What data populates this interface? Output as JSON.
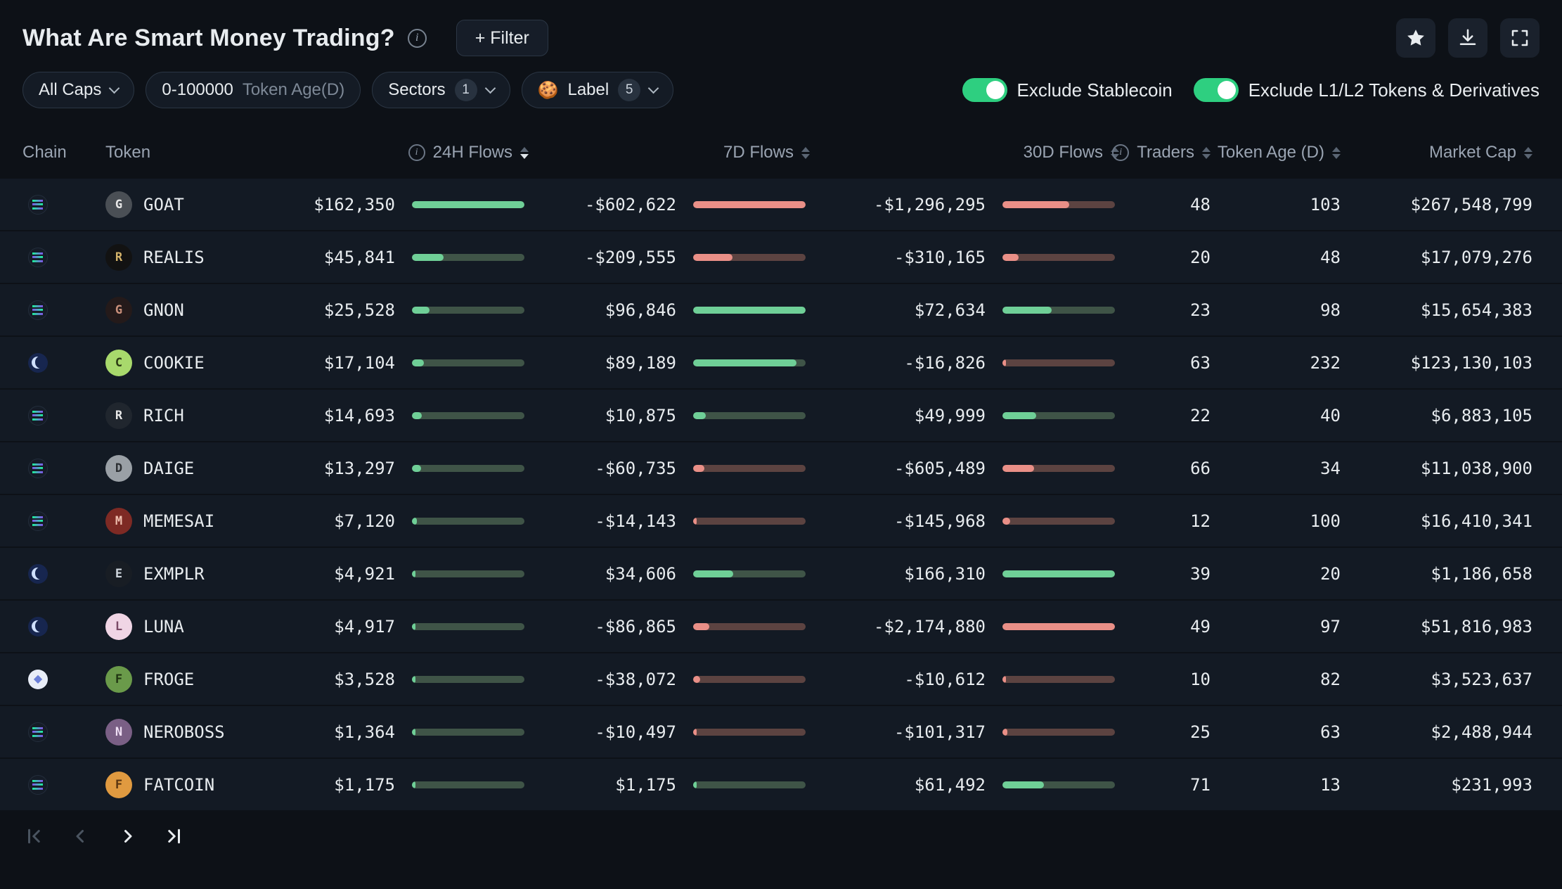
{
  "header": {
    "title": "What Are Smart Money Trading?",
    "filter_button": "+ Filter"
  },
  "filters": {
    "all_caps": "All Caps",
    "token_age_value": "0-100000",
    "token_age_label": "Token Age(D)",
    "sectors_label": "Sectors",
    "sectors_count": "1",
    "label_emoji": "🍪",
    "label_label": "Label",
    "label_count": "5",
    "toggle_stablecoin": "Exclude Stablecoin",
    "toggle_l1l2": "Exclude L1/L2 Tokens & Derivatives"
  },
  "icons": {
    "header_actions": [
      "favorite-icon",
      "download-icon",
      "fullscreen-icon"
    ],
    "pagination": [
      "first-page-icon",
      "prev-page-icon",
      "next-page-icon",
      "last-page-icon"
    ]
  },
  "colors": {
    "bg": "#0d1117",
    "row_bg": "#131a24",
    "accent_green": "#2ecf80",
    "bar_pos": "#6fcf97",
    "bar_pos_track": "#3f5447",
    "bar_neg": "#e98f87",
    "bar_neg_track": "#5c4341"
  },
  "table": {
    "columns": [
      "Chain",
      "Token",
      "24H Flows",
      "7D Flows",
      "30D Flows",
      "Traders",
      "Token Age (D)",
      "Market Cap"
    ],
    "rows": [
      {
        "chain": "solana",
        "token": "GOAT",
        "icon_bg": "#4a4f55",
        "icon_fg": "#e9e9e9",
        "flow_24h": "$162,350",
        "flow_7d": "-$602,622",
        "flow_30d": "-$1,296,295",
        "traders": "48",
        "token_age": "103",
        "market_cap": "$267,548,799"
      },
      {
        "chain": "solana",
        "token": "REALIS",
        "icon_bg": "#121212",
        "icon_fg": "#d4b36a",
        "flow_24h": "$45,841",
        "flow_7d": "-$209,555",
        "flow_30d": "-$310,165",
        "traders": "20",
        "token_age": "48",
        "market_cap": "$17,079,276"
      },
      {
        "chain": "solana",
        "token": "GNON",
        "icon_bg": "#241a1a",
        "icon_fg": "#c98f7a",
        "flow_24h": "$25,528",
        "flow_7d": "$96,846",
        "flow_30d": "$72,634",
        "traders": "23",
        "token_age": "98",
        "market_cap": "$15,654,383"
      },
      {
        "chain": "base",
        "token": "COOKIE",
        "icon_bg": "#a8d96c",
        "icon_fg": "#2b3a14",
        "flow_24h": "$17,104",
        "flow_7d": "$89,189",
        "flow_30d": "-$16,826",
        "traders": "63",
        "token_age": "232",
        "market_cap": "$123,130,103"
      },
      {
        "chain": "solana",
        "token": "RICH",
        "icon_bg": "#20262e",
        "icon_fg": "#e8e8e8",
        "flow_24h": "$14,693",
        "flow_7d": "$10,875",
        "flow_30d": "$49,999",
        "traders": "22",
        "token_age": "40",
        "market_cap": "$6,883,105"
      },
      {
        "chain": "solana",
        "token": "DAIGE",
        "icon_bg": "#9aa0a6",
        "icon_fg": "#2c2f33",
        "flow_24h": "$13,297",
        "flow_7d": "-$60,735",
        "flow_30d": "-$605,489",
        "traders": "66",
        "token_age": "34",
        "market_cap": "$11,038,900"
      },
      {
        "chain": "solana",
        "token": "MEMESAI",
        "icon_bg": "#7e2a24",
        "icon_fg": "#f0c0b0",
        "flow_24h": "$7,120",
        "flow_7d": "-$14,143",
        "flow_30d": "-$145,968",
        "traders": "12",
        "token_age": "100",
        "market_cap": "$16,410,341"
      },
      {
        "chain": "base",
        "token": "EXMPLR",
        "icon_bg": "#181d24",
        "icon_fg": "#cfd6de",
        "flow_24h": "$4,921",
        "flow_7d": "$34,606",
        "flow_30d": "$166,310",
        "traders": "39",
        "token_age": "20",
        "market_cap": "$1,186,658"
      },
      {
        "chain": "base",
        "token": "LUNA",
        "icon_bg": "#f0d5e5",
        "icon_fg": "#7a4a66",
        "flow_24h": "$4,917",
        "flow_7d": "-$86,865",
        "flow_30d": "-$2,174,880",
        "traders": "49",
        "token_age": "97",
        "market_cap": "$51,816,983"
      },
      {
        "chain": "ethereum",
        "token": "FROGE",
        "icon_bg": "#6a9a4a",
        "icon_fg": "#203512",
        "flow_24h": "$3,528",
        "flow_7d": "-$38,072",
        "flow_30d": "-$10,612",
        "traders": "10",
        "token_age": "82",
        "market_cap": "$3,523,637"
      },
      {
        "chain": "solana",
        "token": "NEROBOSS",
        "icon_bg": "#7a5f85",
        "icon_fg": "#f0e0f5",
        "flow_24h": "$1,364",
        "flow_7d": "-$10,497",
        "flow_30d": "-$101,317",
        "traders": "25",
        "token_age": "63",
        "market_cap": "$2,488,944"
      },
      {
        "chain": "solana",
        "token": "FATCOIN",
        "icon_bg": "#e09a40",
        "icon_fg": "#5a3510",
        "flow_24h": "$1,175",
        "flow_7d": "$1,175",
        "flow_30d": "$61,492",
        "traders": "71",
        "token_age": "13",
        "market_cap": "$231,993"
      }
    ]
  }
}
